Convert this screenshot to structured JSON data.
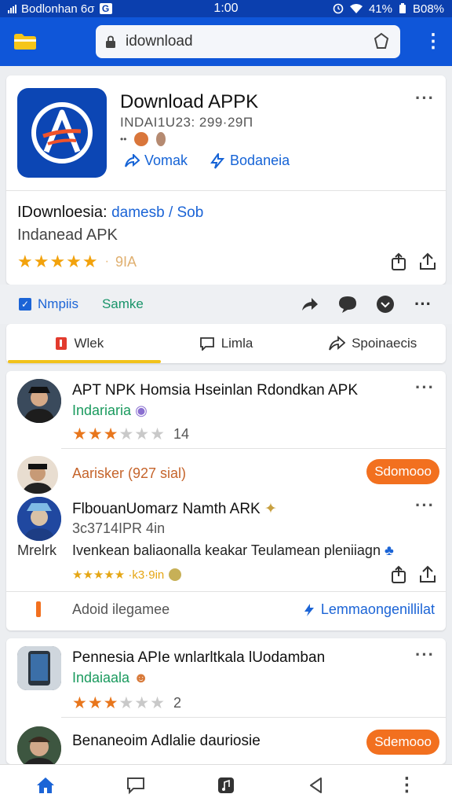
{
  "status_bar": {
    "carrier": "Bodlonhan 6σ",
    "time": "1:00",
    "battery_pct": "41%",
    "battery_label": "B08%"
  },
  "browser": {
    "url": "idownload"
  },
  "app": {
    "title": "Download APPK",
    "meta": "INDAI1U23: 299·29Π",
    "links": [
      "Vomak",
      "Bodaneia"
    ],
    "info_line1": "IDownloesia:",
    "info_line1_sub": "damesb / Sob",
    "info_line2": "Indanead APK",
    "stars": "★★★★★",
    "rating_count": "9IA"
  },
  "actions": {
    "check_label": "Nmpiis",
    "second_label": "Samke"
  },
  "tabs": [
    {
      "label": "Wlek"
    },
    {
      "label": "Limla"
    },
    {
      "label": "Spoinaecis"
    }
  ],
  "posts": {
    "p1": {
      "title": "APT NPK Homsia Hseinlan Rdondkan APK",
      "sub": "Indariaria",
      "stars_on": "★★★",
      "stars_off": "★★★",
      "count": "14"
    },
    "p2": {
      "author": "Aarisker (927 sial)",
      "pill": "Sdomooo",
      "title": "FlbouanUomarz Namth ARK",
      "meta": "3c3714IPR 4in",
      "label_left": "Mrelrk",
      "desc": "Ivenkean baliaonalla keakar Teulamean pleniiagn",
      "small_stars": "★★★★★ ·k3·9in",
      "foot_left": "Adoid ilegamee",
      "foot_right": "Lemmaongenillilat"
    },
    "p3": {
      "title": "Pennesia APIe wnlarltkala lUodamban",
      "sub": "Indaiaala",
      "stars_on": "★★★",
      "stars_off": "★★★",
      "count": "2"
    },
    "p4": {
      "title": "Benaneoim Adlalie dauriosie",
      "pill": "Sdemooo"
    }
  },
  "colors": {
    "brand_blue": "#0f56d9",
    "accent_orange": "#f2701f",
    "star": "#f2a20c",
    "link": "#1b64d6"
  }
}
